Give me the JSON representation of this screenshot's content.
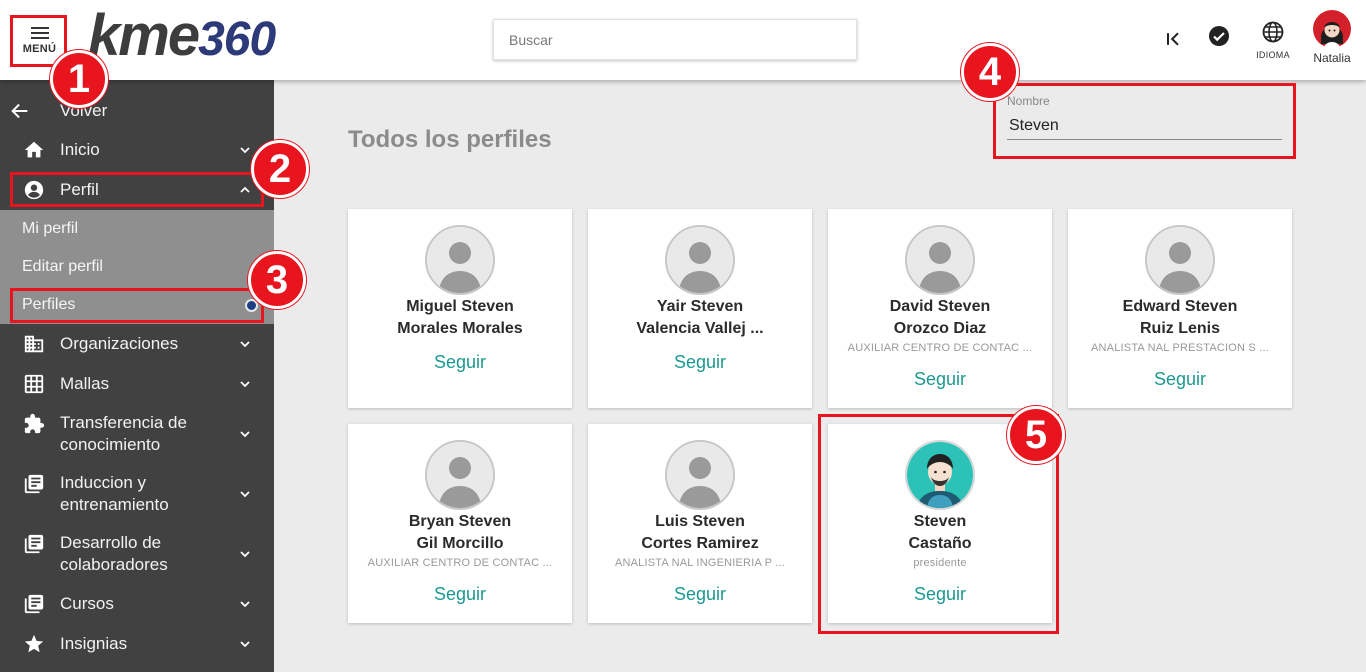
{
  "header": {
    "menu_label": "MENÚ",
    "logo_kme": "kme",
    "logo_360": "360",
    "search_placeholder": "Buscar",
    "language_label": "IDIOMA",
    "user_name": "Natalia"
  },
  "sidebar": {
    "back_label": "Volver",
    "items": [
      {
        "label": "Inicio",
        "icon": "home-icon"
      },
      {
        "label": "Perfil",
        "icon": "account-circle-icon"
      },
      {
        "label": "Organizaciones",
        "icon": "building-icon"
      },
      {
        "label": "Mallas",
        "icon": "grid-icon"
      },
      {
        "label": "Transferencia de conocimiento",
        "line1": "Transferencia de",
        "line2": "conocimiento",
        "icon": "puzzle-icon"
      },
      {
        "label": "Induccion y entrenamiento",
        "line1": "Induccion y",
        "line2": "entrenamiento",
        "icon": "library-books-icon"
      },
      {
        "label": "Desarrollo de colaboradores",
        "line1": "Desarrollo de",
        "line2": "colaboradores",
        "icon": "library-books-icon"
      },
      {
        "label": "Cursos",
        "icon": "library-books-icon"
      },
      {
        "label": "Insignias",
        "icon": "star-icon"
      }
    ],
    "profile_submenu": [
      "Mi perfil",
      "Editar perfil",
      "Perfiles"
    ]
  },
  "main": {
    "title": "Todos los perfiles",
    "filter_label": "Nombre",
    "filter_value": "Steven",
    "follow_label": "Seguir",
    "profiles": [
      {
        "line1": "Miguel Steven",
        "line2": "Morales Morales",
        "role": ""
      },
      {
        "line1": "Yair Steven",
        "line2": "Valencia Vallej ...",
        "role": ""
      },
      {
        "line1": "David Steven",
        "line2": "Orozco Diaz",
        "role": "AUXILIAR CENTRO DE CONTAC ..."
      },
      {
        "line1": "Edward Steven",
        "line2": "Ruiz Lenis",
        "role": "ANALISTA NAL PRESTACION S ..."
      },
      {
        "line1": "Bryan Steven",
        "line2": "Gil Morcillo",
        "role": "AUXILIAR CENTRO DE CONTAC ..."
      },
      {
        "line1": "Luis Steven",
        "line2": "Cortes Ramirez",
        "role": "ANALISTA NAL INGENIERIA P ..."
      },
      {
        "line1": "Steven",
        "line2": "Castaño",
        "role": "presidente"
      }
    ]
  },
  "annotations": [
    "1",
    "2",
    "3",
    "4",
    "5"
  ],
  "colors": {
    "accent": "#1a9a90",
    "annotation": "#e8141e",
    "sidebar": "#414141",
    "brand": "#2d3a7a"
  }
}
